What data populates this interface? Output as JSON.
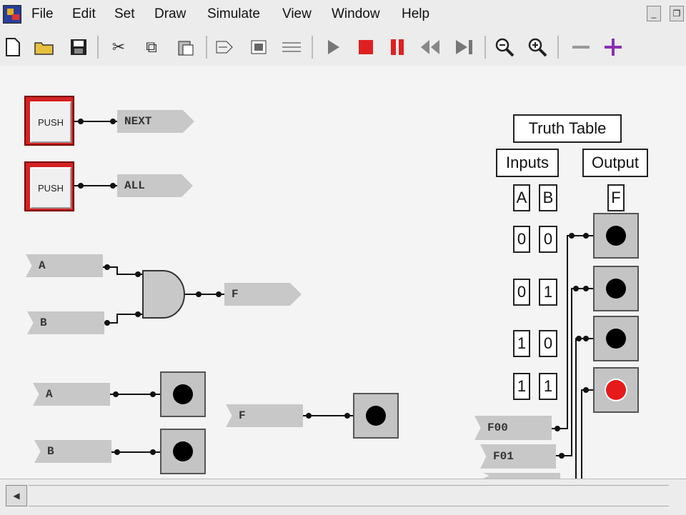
{
  "menubar": {
    "items": [
      "File",
      "Edit",
      "Set",
      "Draw",
      "Simulate",
      "View",
      "Window",
      "Help"
    ]
  },
  "toolbar": {
    "icons": [
      "new-file-icon",
      "open-folder-icon",
      "save-icon",
      "cut-icon",
      "copy-icon",
      "paste-icon",
      "wire-tool-icon",
      "component-icon",
      "gate-tool-icon",
      "run-icon",
      "stop-icon",
      "pause-icon",
      "step-back-icon",
      "step-forward-icon",
      "zoom-out-icon",
      "zoom-in-icon",
      "minus-icon",
      "plus-icon"
    ],
    "accent_red": "#e02020",
    "accent_purple": "#8a2fb3"
  },
  "canvas": {
    "push_buttons": [
      {
        "label": "PUSH"
      },
      {
        "label": "PUSH"
      }
    ],
    "output_tags": [
      {
        "label": "NEXT"
      },
      {
        "label": "ALL"
      },
      {
        "label": "F"
      }
    ],
    "input_tags": [
      {
        "label": "A"
      },
      {
        "label": "B"
      },
      {
        "label": "A"
      },
      {
        "label": "B"
      },
      {
        "label": "F"
      }
    ],
    "truth_table": {
      "title": "Truth Table",
      "inputs_header": "Inputs",
      "output_header": "Output",
      "col_a": "A",
      "col_b": "B",
      "col_f": "F",
      "rows": [
        {
          "a": "0",
          "b": "0",
          "on": false
        },
        {
          "a": "0",
          "b": "1",
          "on": false
        },
        {
          "a": "1",
          "b": "0",
          "on": false
        },
        {
          "a": "1",
          "b": "1",
          "on": true
        }
      ]
    },
    "bus_tags": [
      {
        "label": "F00"
      },
      {
        "label": "F01"
      }
    ],
    "led_on_color": "#e61a1a",
    "led_off_color": "#000000"
  }
}
